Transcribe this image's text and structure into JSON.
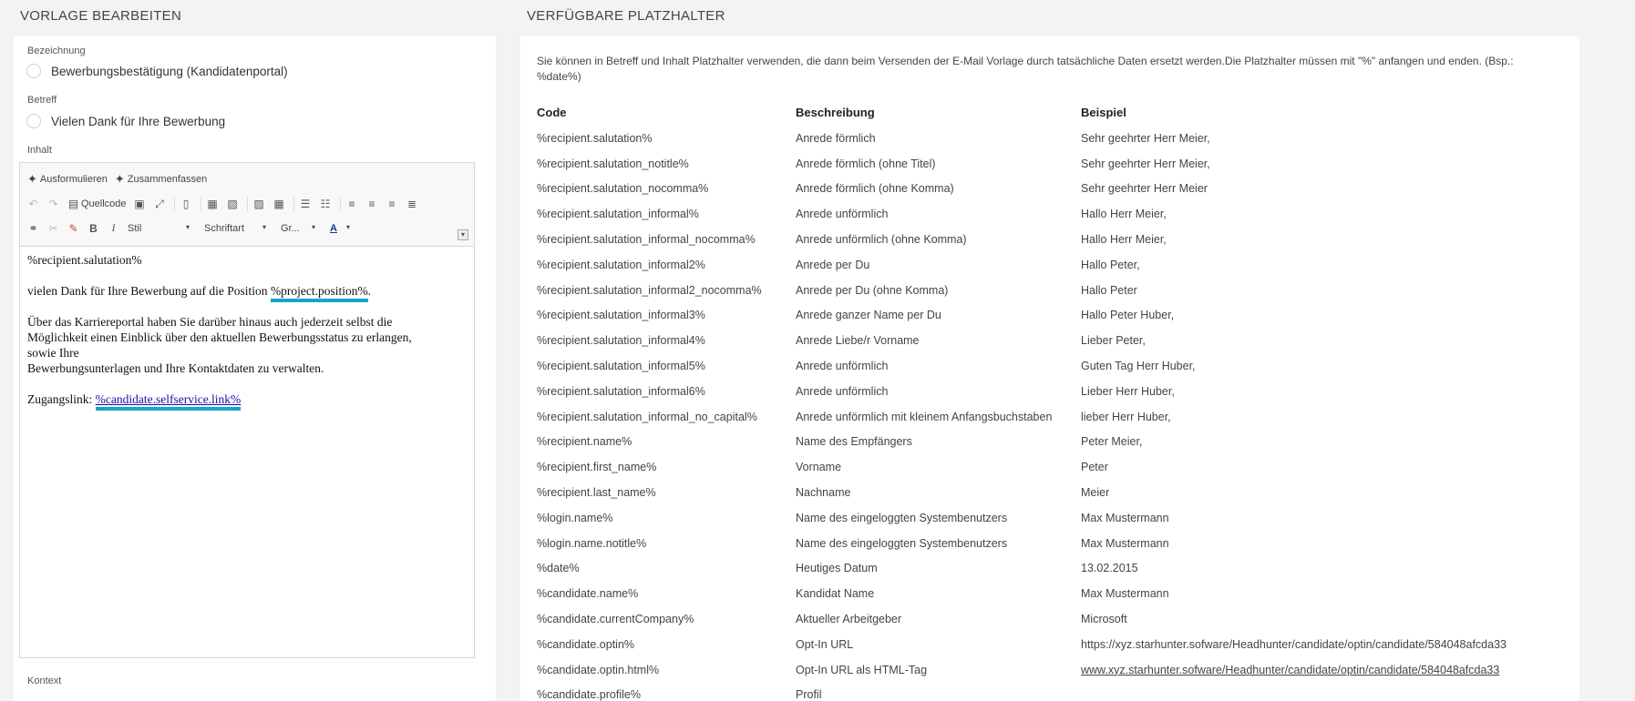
{
  "left": {
    "title": "VORLAGE BEARBEITEN",
    "bezeichnung_label": "Bezeichnung",
    "bezeichnung_value": "Bewerbungsbestätigung (Kandidatenportal)",
    "betreff_label": "Betreff",
    "betreff_value": "Vielen Dank für Ihre Bewerbung",
    "inhalt_label": "Inhalt",
    "kontext_label": "Kontext",
    "toolbar": {
      "ausformulieren": "Ausformulieren",
      "zusammenfassen": "Zusammenfassen",
      "quellcode": "Quellcode",
      "bold": "B",
      "italic": "I",
      "stil": "Stil",
      "schriftart": "Schriftart",
      "groesse": "Gr...",
      "font_color": "A"
    },
    "content": {
      "line1": "%recipient.salutation%",
      "line2_pre": "vielen Dank für Ihre Bewerbung auf die Position ",
      "line2_placeholder": "%project.position%",
      "line2_post": ".",
      "para3_l1": "Über das Karriereportal haben Sie darüber hinaus auch jederzeit selbst die",
      "para3_l2": "Möglichkeit einen Einblick über den aktuellen Bewerbungsstatus zu erlangen,",
      "para3_l3": "sowie Ihre",
      "para3_l4": "Bewerbungsunterlagen und Ihre Kontaktdaten zu verwalten.",
      "link_label": "Zugangslink: ",
      "link_value": "%candidate.selfservice.link%"
    }
  },
  "right": {
    "title": "VERFÜGBARE PLATZHALTER",
    "intro": "Sie können in Betreff und Inhalt Platzhalter verwenden, die dann beim Versenden der E-Mail Vorlage durch tatsächliche Daten ersetzt werden.Die Platzhalter müssen mit \"%\" anfangen und enden. (Bsp.: %date%)",
    "headers": {
      "code": "Code",
      "beschreibung": "Beschreibung",
      "beispiel": "Beispiel"
    },
    "rows": [
      {
        "code": "%recipient.salutation%",
        "desc": "Anrede förmlich",
        "example": "Sehr geehrter Herr Meier,"
      },
      {
        "code": "%recipient.salutation_notitle%",
        "desc": "Anrede förmlich (ohne Titel)",
        "example": "Sehr geehrter Herr Meier,"
      },
      {
        "code": "%recipient.salutation_nocomma%",
        "desc": "Anrede förmlich (ohne Komma)",
        "example": "Sehr geehrter Herr Meier"
      },
      {
        "code": "%recipient.salutation_informal%",
        "desc": "Anrede unförmlich",
        "example": "Hallo Herr Meier,"
      },
      {
        "code": "%recipient.salutation_informal_nocomma%",
        "desc": "Anrede unförmlich (ohne Komma)",
        "example": "Hallo Herr Meier,"
      },
      {
        "code": "%recipient.salutation_informal2%",
        "desc": "Anrede per Du",
        "example": "Hallo Peter,"
      },
      {
        "code": "%recipient.salutation_informal2_nocomma%",
        "desc": "Anrede per Du (ohne Komma)",
        "example": "Hallo Peter"
      },
      {
        "code": "%recipient.salutation_informal3%",
        "desc": "Anrede ganzer Name per Du",
        "example": "Hallo Peter Huber,"
      },
      {
        "code": "%recipient.salutation_informal4%",
        "desc": "Anrede Liebe/r Vorname",
        "example": "Lieber Peter,"
      },
      {
        "code": "%recipient.salutation_informal5%",
        "desc": "Anrede unförmlich",
        "example": "Guten Tag Herr Huber,"
      },
      {
        "code": "%recipient.salutation_informal6%",
        "desc": "Anrede unförmlich",
        "example": "Lieber Herr Huber,"
      },
      {
        "code": "%recipient.salutation_informal_no_capital%",
        "desc": "Anrede unförmlich mit kleinem Anfangsbuchstaben",
        "example": "lieber Herr Huber,"
      },
      {
        "code": "%recipient.name%",
        "desc": "Name des Empfängers",
        "example": "Peter Meier,"
      },
      {
        "code": "%recipient.first_name%",
        "desc": "Vorname",
        "example": "Peter"
      },
      {
        "code": "%recipient.last_name%",
        "desc": "Nachname",
        "example": "Meier"
      },
      {
        "code": "%login.name%",
        "desc": "Name des eingeloggten Systembenutzers",
        "example": "Max Mustermann"
      },
      {
        "code": "%login.name.notitle%",
        "desc": "Name des eingeloggten Systembenutzers",
        "example": "Max Mustermann"
      },
      {
        "code": "%date%",
        "desc": "Heutiges Datum",
        "example": "13.02.2015"
      },
      {
        "code": "%candidate.name%",
        "desc": "Kandidat Name",
        "example": "Max Mustermann"
      },
      {
        "code": "%candidate.currentCompany%",
        "desc": "Aktueller Arbeitgeber",
        "example": "Microsoft"
      },
      {
        "code": "%candidate.optin%",
        "desc": "Opt-In URL",
        "example": "https://xyz.starhunter.sofware/Headhunter/candidate/optin/candidate/584048afcda33"
      },
      {
        "code": "%candidate.optin.html%",
        "desc": "Opt-In URL als HTML-Tag",
        "example": "www.xyz.starhunter.sofware/Headhunter/candidate/optin/candidate/584048afcda33",
        "is_link": true
      },
      {
        "code": "%candidate.profile%",
        "desc": "Profil",
        "example": ""
      }
    ]
  }
}
